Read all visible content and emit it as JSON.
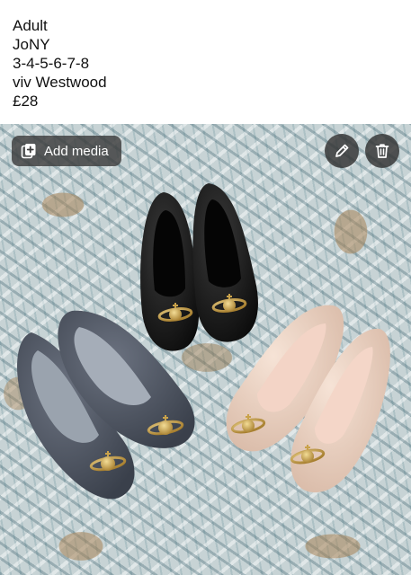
{
  "listing": {
    "lines": [
      "Adult",
      "JoNY",
      "3-4-5-6-7-8",
      "viv Westwood",
      "£28"
    ]
  },
  "media": {
    "add_media_label": "Add media",
    "icons": {
      "add_media": "add-media-icon",
      "edit": "pencil-icon",
      "delete": "trash-icon"
    }
  },
  "colors": {
    "overlay_button": "#3c3c3c",
    "text": "#111111",
    "shoe_black": "#141414",
    "shoe_grey": "#4c5360",
    "shoe_nude": "#e8cdbd",
    "ornament_gold": "#c9a24a"
  }
}
